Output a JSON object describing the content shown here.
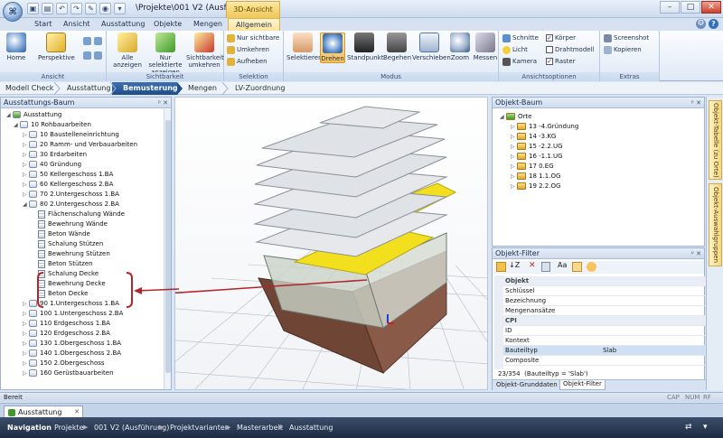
{
  "window": {
    "title": "\\Projekte\\001 V2 (Ausführun...",
    "context_tab_title": "3D-Ansicht"
  },
  "ribbon_tabs": [
    "Start",
    "Ansicht",
    "Ausstattung",
    "Objekte",
    "Mengen",
    "Allgemein"
  ],
  "ribbon": {
    "groups": [
      {
        "label": "Ansicht"
      },
      {
        "label": "Sichtbarkeit"
      },
      {
        "label": "Selektion"
      },
      {
        "label": "Modus"
      },
      {
        "label": "Ansichtsoptionen"
      },
      {
        "label": "Extras"
      }
    ],
    "ansicht": {
      "home": "Home",
      "perspektive": "Perspektive"
    },
    "sichtbarkeit": {
      "alle": "Alle anzeigen",
      "nur_sel": "Nur selektierte anzeigen",
      "umkehren": "Sichtbarkeit umkehren"
    },
    "selektion": {
      "nur_sichtbare": "Nur sichtbare",
      "umkehren": "Umkehren",
      "aufheben": "Aufheben"
    },
    "modus": [
      "Selektieren",
      "Drehen",
      "Standpunkt",
      "Begehen",
      "Verschieben",
      "Zoom",
      "Messen"
    ],
    "optionen": {
      "schnitte": "Schnitte",
      "licht": "Licht",
      "kamera": "Kamera",
      "koerper": "Körper",
      "draht": "Drahtmodell",
      "raster": "Raster"
    },
    "extras": {
      "screenshot": "Screenshot",
      "kopieren": "Kopieren"
    }
  },
  "workflow": [
    "Modell Check",
    "Ausstattung",
    "Bemusterung",
    "Mengen",
    "LV-Zuordnung"
  ],
  "left_panel": {
    "title": "Ausstattungs-Baum",
    "tree": [
      {
        "label": "Ausstattung",
        "level": 0,
        "icon": "green",
        "twisty": "◢"
      },
      {
        "label": "10 Rohbauarbeiten",
        "level": 1,
        "icon": "folder",
        "twisty": "◢"
      },
      {
        "label": "10 Baustelleneinrichtung",
        "level": 2,
        "icon": "folder",
        "twisty": "▷"
      },
      {
        "label": "20 Ramm- und Verbauarbeiten",
        "level": 2,
        "icon": "folder",
        "twisty": "▷"
      },
      {
        "label": "30 Erdarbeiten",
        "level": 2,
        "icon": "folder",
        "twisty": "▷"
      },
      {
        "label": "40 Gründung",
        "level": 2,
        "icon": "folder",
        "twisty": "▷"
      },
      {
        "label": "50 Kellergeschoss 1.BA",
        "level": 2,
        "icon": "folder",
        "twisty": "▷"
      },
      {
        "label": "60 Kellergeschoss 2.BA",
        "level": 2,
        "icon": "folder",
        "twisty": "▷"
      },
      {
        "label": "70 2.Untergeschoss 1.BA",
        "level": 2,
        "icon": "folder",
        "twisty": "▷"
      },
      {
        "label": "80 2.Untergeschoss 2.BA",
        "level": 2,
        "icon": "folder",
        "twisty": "◢"
      },
      {
        "label": "Flächenschalung Wände",
        "level": 3,
        "icon": "doc",
        "twisty": ""
      },
      {
        "label": "Bewehrung  Wände",
        "level": 3,
        "icon": "doc",
        "twisty": ""
      },
      {
        "label": "Beton Wände",
        "level": 3,
        "icon": "doc",
        "twisty": ""
      },
      {
        "label": "Schalung Stützen",
        "level": 3,
        "icon": "doc",
        "twisty": ""
      },
      {
        "label": "Bewehrung Stützen",
        "level": 3,
        "icon": "doc",
        "twisty": ""
      },
      {
        "label": "Beton Stützen",
        "level": 3,
        "icon": "doc",
        "twisty": ""
      },
      {
        "label": "Schalung Decke",
        "level": 3,
        "icon": "doc",
        "twisty": ""
      },
      {
        "label": "Bewehrung Decke",
        "level": 3,
        "icon": "doc",
        "twisty": ""
      },
      {
        "label": "Beton Decke",
        "level": 3,
        "icon": "doc",
        "twisty": ""
      },
      {
        "label": "90 1.Untergeschoss 1.BA",
        "level": 2,
        "icon": "folder",
        "twisty": "▷"
      },
      {
        "label": "100 1.Untergeschoss 2.BA",
        "level": 2,
        "icon": "folder",
        "twisty": "▷"
      },
      {
        "label": "110 Erdgeschoss 1.BA",
        "level": 2,
        "icon": "folder",
        "twisty": "▷"
      },
      {
        "label": "120 Erdgeschoss 2.BA",
        "level": 2,
        "icon": "folder",
        "twisty": "▷"
      },
      {
        "label": "130 1.Obergeschoss 1.BA",
        "level": 2,
        "icon": "folder",
        "twisty": "▷"
      },
      {
        "label": "140 1.Obergeschoss 2.BA",
        "level": 2,
        "icon": "folder",
        "twisty": "▷"
      },
      {
        "label": "150 2.Obergeschoss",
        "level": 2,
        "icon": "folder",
        "twisty": "▷"
      },
      {
        "label": "160 Gerüstbauarbeiten",
        "level": 2,
        "icon": "folder",
        "twisty": "▷"
      }
    ]
  },
  "object_tree": {
    "title": "Objekt-Baum",
    "root": "Orte",
    "items": [
      "13 -4.Gründung",
      "14 -3.KG",
      "15 -2.2.UG",
      "16 -1.1.UG",
      "17 0.EG",
      "18 1.1.OG",
      "19 2.2.OG"
    ]
  },
  "object_filter": {
    "title": "Objekt-Filter",
    "rows": [
      {
        "name": "Objekt",
        "value": "",
        "category": true
      },
      {
        "name": "Schlüssel",
        "value": ""
      },
      {
        "name": "Bezeichnung",
        "value": ""
      },
      {
        "name": "Mengenansätze",
        "value": ""
      },
      {
        "name": "CPI",
        "value": "",
        "category": true
      },
      {
        "name": "ID",
        "value": ""
      },
      {
        "name": "Kontext",
        "value": ""
      },
      {
        "name": "Bauteiltyp",
        "value": "Slab",
        "selected": true
      },
      {
        "name": "Composite",
        "value": ""
      }
    ],
    "count": "23/354",
    "filter_expr": "(Bauteiltyp = 'Slab')",
    "tabs": [
      "Objekt-Grunddaten",
      "Objekt-Filter"
    ]
  },
  "side_tabs": [
    "Objekt-Tabelle (zu Orte)",
    "Objekt-Auswahlgruppen"
  ],
  "status": {
    "left": "Bereit",
    "right": [
      "CAP",
      "NUM",
      "RF"
    ]
  },
  "document_tab": "Ausstattung",
  "navigation": {
    "label": "Navigation",
    "crumbs": [
      "Projekte",
      "001 V2 (Ausführung)",
      "Projektvarianten",
      "Masterarbeit",
      "Ausstattung"
    ]
  },
  "colors": {
    "accent": "#1f4d8c",
    "highlight": "#f2e01f",
    "annotation": "#b4252a",
    "brick": "#8a5a48"
  }
}
